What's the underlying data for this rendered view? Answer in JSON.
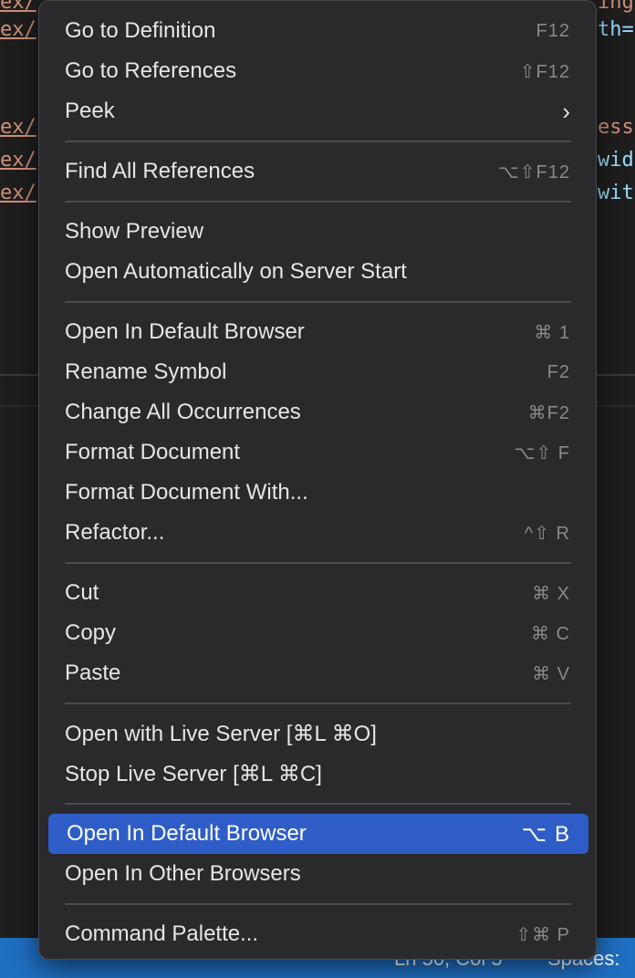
{
  "editor": {
    "left_fragments": [
      "ex/",
      "ex/",
      "ex/",
      "ex/",
      "ex/"
    ],
    "right_fragments": [
      "ing",
      "th=",
      "ess",
      "wid",
      "wit"
    ],
    "status": {
      "position": "Ln 50, Col 5",
      "spaces": "Spaces:"
    }
  },
  "menu": {
    "groups": [
      [
        {
          "label": "Go to Definition",
          "shortcut": "F12"
        },
        {
          "label": "Go to References",
          "shortcut": "⇧F12"
        },
        {
          "label": "Peek",
          "shortcut": "›"
        }
      ],
      [
        {
          "label": "Find All References",
          "shortcut": "⌥⇧F12"
        }
      ],
      [
        {
          "label": "Show Preview",
          "shortcut": ""
        },
        {
          "label": "Open Automatically on Server Start",
          "shortcut": ""
        }
      ],
      [
        {
          "label": "Open In Default Browser",
          "shortcut": "⌘ 1"
        },
        {
          "label": "Rename Symbol",
          "shortcut": "F2"
        },
        {
          "label": "Change All Occurrences",
          "shortcut": "⌘F2"
        },
        {
          "label": "Format Document",
          "shortcut": "⌥⇧ F"
        },
        {
          "label": "Format Document With...",
          "shortcut": ""
        },
        {
          "label": "Refactor...",
          "shortcut": "^⇧ R"
        }
      ],
      [
        {
          "label": "Cut",
          "shortcut": "⌘ X"
        },
        {
          "label": "Copy",
          "shortcut": "⌘ C"
        },
        {
          "label": "Paste",
          "shortcut": "⌘ V"
        }
      ],
      [
        {
          "label": "Open with Live Server [⌘L ⌘O]",
          "shortcut": ""
        },
        {
          "label": "Stop Live Server [⌘L ⌘C]",
          "shortcut": ""
        }
      ],
      [
        {
          "label": "Open In Default Browser",
          "shortcut": "⌥ B",
          "active": true
        },
        {
          "label": "Open In Other Browsers",
          "shortcut": ""
        }
      ],
      [
        {
          "label": "Command Palette...",
          "shortcut": "⇧⌘ P"
        }
      ]
    ]
  },
  "colors": {
    "menu_bg": "#2a2a2c",
    "highlight": "#2f5dc7",
    "status_bar": "#1f6fc2"
  }
}
